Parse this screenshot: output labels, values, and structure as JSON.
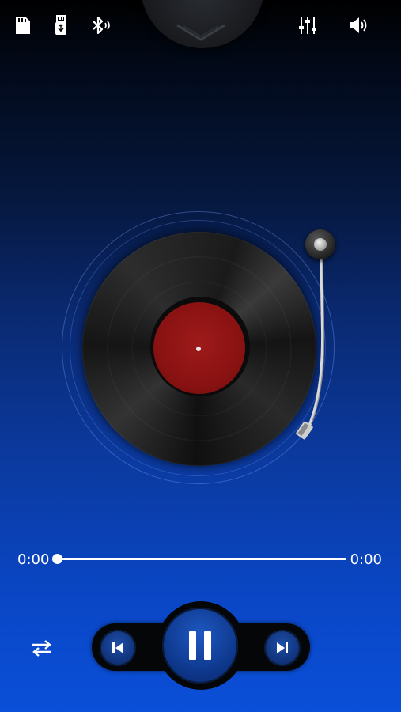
{
  "status_bar": {
    "icons": [
      "sd-card-icon",
      "usb-icon",
      "bluetooth-icon",
      "equalizer-icon",
      "volume-icon"
    ]
  },
  "player": {
    "elapsed": "0:00",
    "duration": "0:00",
    "progress": 0,
    "state": "playing"
  },
  "controls": {
    "repeat_icon": "repeat-icon",
    "prev_icon": "previous-icon",
    "play_pause_icon": "pause-icon",
    "next_icon": "next-icon"
  },
  "colors": {
    "accent": "#0b3aa0",
    "record_label": "#8a1212",
    "button_blue": "#1e58c2"
  }
}
